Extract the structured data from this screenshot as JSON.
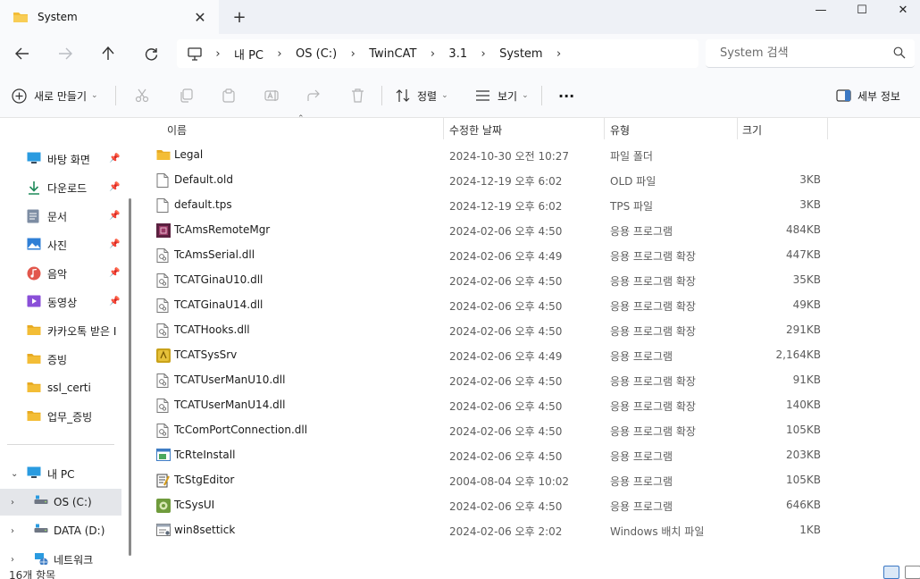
{
  "tab": {
    "title": "System",
    "close_label": "✕",
    "new_label": "+"
  },
  "window": {
    "minimize": "—",
    "maximize": "☐",
    "close": "✕"
  },
  "address": {
    "crumbs": [
      "내 PC",
      "OS (C:)",
      "TwinCAT",
      "3.1",
      "System"
    ],
    "search_placeholder": "System 검색"
  },
  "commands": {
    "new_label": "새로 만들기",
    "sort_label": "정렬",
    "view_label": "보기",
    "more_label": "···",
    "details_label": "세부 정보"
  },
  "sidebar": {
    "quick": [
      {
        "label": "바탕 화면",
        "icon": "desktop-icon",
        "color": "#2a9be0",
        "pinned": true
      },
      {
        "label": "다운로드",
        "icon": "download-icon",
        "color": "#1f8a5a",
        "pinned": true
      },
      {
        "label": "문서",
        "icon": "document-icon",
        "color": "#7d8da3",
        "pinned": true
      },
      {
        "label": "사진",
        "icon": "pictures-icon",
        "color": "#2f7fd6",
        "pinned": true
      },
      {
        "label": "음악",
        "icon": "music-icon",
        "color": "#e2574c",
        "pinned": true
      },
      {
        "label": "동영상",
        "icon": "video-icon",
        "color": "#8a4fd8",
        "pinned": true
      },
      {
        "label": "카카오톡 받은 I",
        "icon": "folder-icon",
        "color": "#f3bd36",
        "pinned": false
      },
      {
        "label": "증빙",
        "icon": "folder-icon",
        "color": "#f3bd36",
        "pinned": false
      },
      {
        "label": "ssl_certi",
        "icon": "folder-icon",
        "color": "#f3bd36",
        "pinned": false
      },
      {
        "label": "업무_증빙",
        "icon": "folder-icon",
        "color": "#f3bd36",
        "pinned": false
      }
    ],
    "tree": [
      {
        "label": "내 PC",
        "icon": "pc-icon",
        "expander": "⌄"
      },
      {
        "label": "OS (C:)",
        "icon": "drive-icon",
        "expander": "›"
      },
      {
        "label": "DATA (D:)",
        "icon": "drive-icon",
        "expander": "›"
      },
      {
        "label": "네트워크",
        "icon": "network-icon",
        "expander": "›"
      }
    ]
  },
  "columns": {
    "name": "이름",
    "date": "수정한 날짜",
    "type": "유형",
    "size": "크기"
  },
  "files": [
    {
      "name": "Legal",
      "date": "2024-10-30 오전 10:27",
      "type": "파일 폴더",
      "size": "",
      "icon": "folder-icon"
    },
    {
      "name": "Default.old",
      "date": "2024-12-19 오후 6:02",
      "type": "OLD 파일",
      "size": "3KB",
      "icon": "file-icon"
    },
    {
      "name": "default.tps",
      "date": "2024-12-19 오후 6:02",
      "type": "TPS 파일",
      "size": "3KB",
      "icon": "file-icon"
    },
    {
      "name": "TcAmsRemoteMgr",
      "date": "2024-02-06 오후 4:50",
      "type": "응용 프로그램",
      "size": "484KB",
      "icon": "remote-mgr-icon"
    },
    {
      "name": "TcAmsSerial.dll",
      "date": "2024-02-06 오후 4:49",
      "type": "응용 프로그램 확장",
      "size": "447KB",
      "icon": "dll-icon"
    },
    {
      "name": "TCATGinaU10.dll",
      "date": "2024-02-06 오후 4:50",
      "type": "응용 프로그램 확장",
      "size": "35KB",
      "icon": "dll-icon"
    },
    {
      "name": "TCATGinaU14.dll",
      "date": "2024-02-06 오후 4:50",
      "type": "응용 프로그램 확장",
      "size": "49KB",
      "icon": "dll-icon"
    },
    {
      "name": "TCATHooks.dll",
      "date": "2024-02-06 오후 4:50",
      "type": "응용 프로그램 확장",
      "size": "291KB",
      "icon": "dll-icon"
    },
    {
      "name": "TCATSysSrv",
      "date": "2024-02-06 오후 4:49",
      "type": "응용 프로그램",
      "size": "2,164KB",
      "icon": "sys-srv-icon"
    },
    {
      "name": "TCATUserManU10.dll",
      "date": "2024-02-06 오후 4:50",
      "type": "응용 프로그램 확장",
      "size": "91KB",
      "icon": "dll-icon"
    },
    {
      "name": "TCATUserManU14.dll",
      "date": "2024-02-06 오후 4:50",
      "type": "응용 프로그램 확장",
      "size": "140KB",
      "icon": "dll-icon"
    },
    {
      "name": "TcComPortConnection.dll",
      "date": "2024-02-06 오후 4:50",
      "type": "응용 프로그램 확장",
      "size": "105KB",
      "icon": "dll-icon"
    },
    {
      "name": "TcRteInstall",
      "date": "2024-02-06 오후 4:50",
      "type": "응용 프로그램",
      "size": "203KB",
      "icon": "installer-icon"
    },
    {
      "name": "TcStgEditor",
      "date": "2004-08-04 오후 10:02",
      "type": "응용 프로그램",
      "size": "105KB",
      "icon": "editor-icon"
    },
    {
      "name": "TcSysUI",
      "date": "2024-02-06 오후 4:50",
      "type": "응용 프로그램",
      "size": "646KB",
      "icon": "sysui-icon"
    },
    {
      "name": "win8settick",
      "date": "2024-02-06 오후 2:02",
      "type": "Windows 배치 파일",
      "size": "1KB",
      "icon": "batch-file-icon"
    }
  ],
  "status": {
    "count": "16개 항목"
  }
}
